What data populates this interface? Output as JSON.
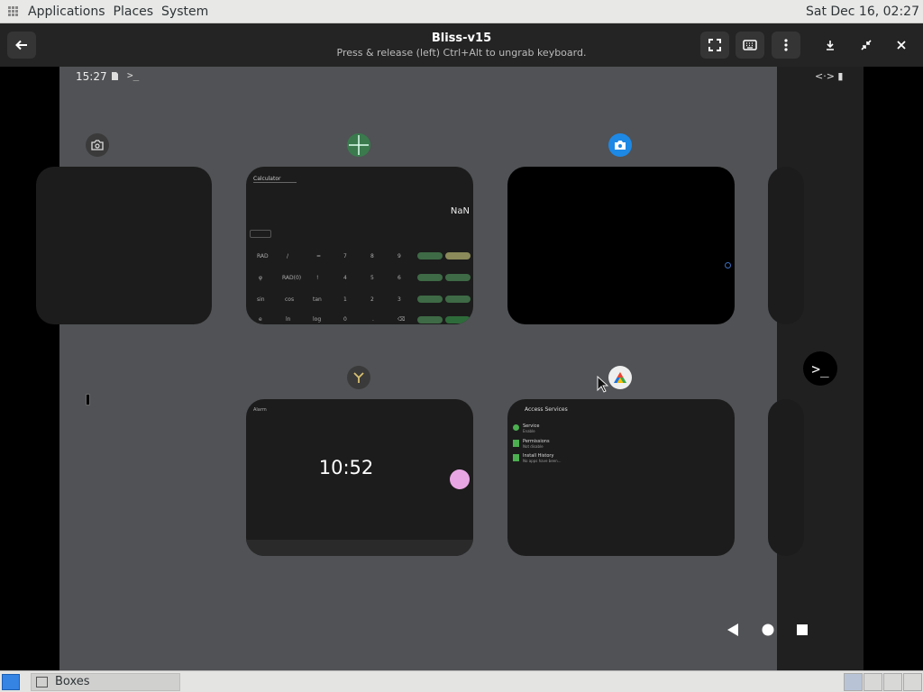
{
  "topbar": {
    "menus": [
      "Applications",
      "Places",
      "System"
    ],
    "clock": "Sat Dec 16, 02:27"
  },
  "header": {
    "title": "Bliss-v15",
    "subtitle": "Press & release (left) Ctrl+Alt to ungrab keyboard."
  },
  "android": {
    "status_time": "15:27",
    "status_right": "<·> ▮",
    "calculator": {
      "app_label": "Calculator",
      "display_value": "NaN",
      "keys": [
        "RAD",
        "/",
        "=",
        "7",
        "8",
        "9",
        "φ",
        "RAD(0)",
        "!",
        "4",
        "5",
        "6",
        "sin",
        "cos",
        "tan",
        "1",
        "2",
        "3",
        "e",
        "ln",
        "log",
        "0",
        ".",
        "⌫"
      ]
    },
    "clock_app": {
      "time": "10:52",
      "header_label": "Alarm"
    },
    "access_services": {
      "title": "Access Services",
      "items": [
        {
          "title": "Service",
          "sub": "Enable"
        },
        {
          "title": "Permissions",
          "sub": "Not disable"
        },
        {
          "title": "Install History",
          "sub": "No apps have been..."
        }
      ]
    }
  },
  "taskbar": {
    "task_label": "Boxes"
  },
  "colors": {
    "screen_bg": "#505255",
    "card_bg": "#1c1c1c",
    "calc_accent": "#3e6a45",
    "headerbar_bg": "#242424"
  }
}
